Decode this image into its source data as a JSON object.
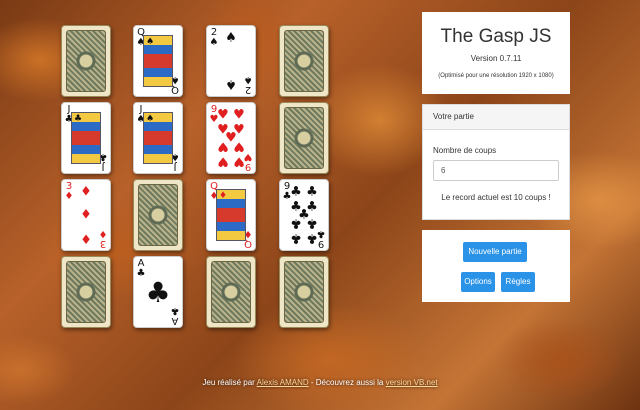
{
  "app": {
    "title": "The Gasp JS",
    "version": "Version 0.7.11",
    "resolution_note": "(Optimisé pour une résolution 1920 x 1080)"
  },
  "game_panel": {
    "header": "Votre partie",
    "moves_label": "Nombre de coups",
    "moves_value": "6",
    "record_text": "Le record actuel est 10 coups !"
  },
  "buttons": {
    "new_game": "Nouvelle partie",
    "options": "Options",
    "rules": "Règles"
  },
  "footer": {
    "prefix": "Jeu réalisé par",
    "author": "Alexis AMAND",
    "middle": " - Découvrez aussi la",
    "link": "version VB.net"
  },
  "board": {
    "cards": [
      {
        "row": 0,
        "col": 0,
        "face": "down"
      },
      {
        "row": 0,
        "col": 1,
        "face": "up",
        "rank": "Q",
        "suit": "spades"
      },
      {
        "row": 0,
        "col": 2,
        "face": "up",
        "rank": "2",
        "suit": "spades"
      },
      {
        "row": 0,
        "col": 3,
        "face": "down"
      },
      {
        "row": 1,
        "col": 0,
        "face": "up",
        "rank": "J",
        "suit": "clubs"
      },
      {
        "row": 1,
        "col": 1,
        "face": "up",
        "rank": "J",
        "suit": "spades"
      },
      {
        "row": 1,
        "col": 2,
        "face": "up",
        "rank": "9",
        "suit": "hearts"
      },
      {
        "row": 1,
        "col": 3,
        "face": "down"
      },
      {
        "row": 2,
        "col": 0,
        "face": "up",
        "rank": "3",
        "suit": "diamonds"
      },
      {
        "row": 2,
        "col": 1,
        "face": "down"
      },
      {
        "row": 2,
        "col": 2,
        "face": "up",
        "rank": "Q",
        "suit": "diamonds"
      },
      {
        "row": 2,
        "col": 3,
        "face": "up",
        "rank": "9",
        "suit": "clubs"
      },
      {
        "row": 3,
        "col": 0,
        "face": "down"
      },
      {
        "row": 3,
        "col": 1,
        "face": "up",
        "rank": "A",
        "suit": "clubs"
      },
      {
        "row": 3,
        "col": 2,
        "face": "down"
      },
      {
        "row": 3,
        "col": 3,
        "face": "down"
      }
    ]
  },
  "colors": {
    "button": "#2a93e8",
    "red_suit": "#e02020",
    "black_suit": "#111111"
  }
}
